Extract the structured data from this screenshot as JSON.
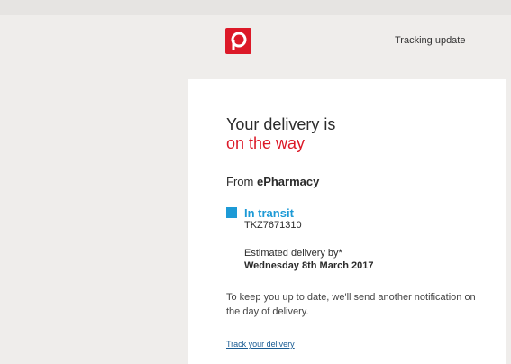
{
  "header": {
    "logo_icon": "australia-post-logo-icon",
    "title": "Tracking update"
  },
  "colors": {
    "brand_red": "#dc1928",
    "status_blue": "#1d9ad6",
    "link": "#1a5c93"
  },
  "email": {
    "headline_line1": "Your delivery is",
    "headline_line2": "on the way",
    "from_prefix": "From",
    "from_name": "ePharmacy",
    "status": {
      "icon": "status-square-icon",
      "label": "In transit",
      "tracking_number": "TKZ7671310"
    },
    "estimate": {
      "label": "Estimated delivery by*",
      "date": "Wednesday 8th March 2017"
    },
    "notice": "To keep you up to date, we'll send another notification on the day of delivery.",
    "track_link": "Track your delivery"
  }
}
